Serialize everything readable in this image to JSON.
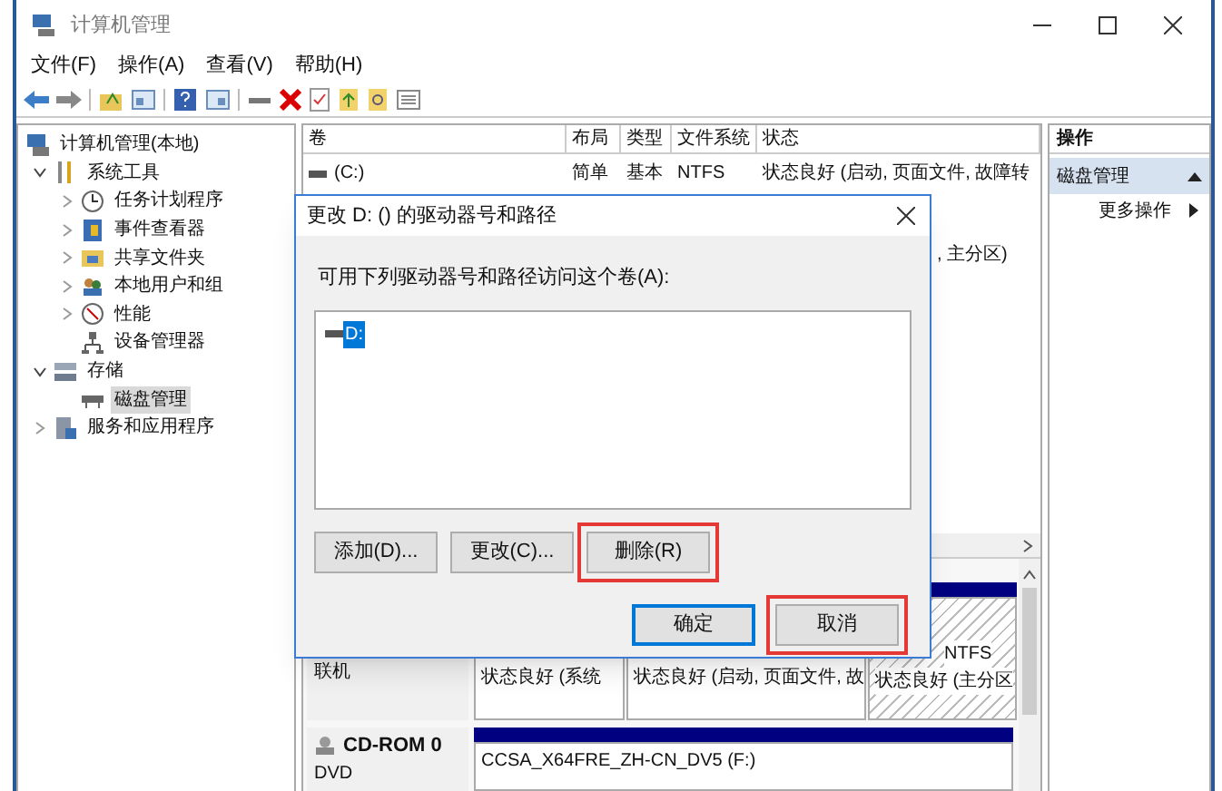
{
  "window": {
    "title": "计算机管理"
  },
  "menu": [
    "文件(F)",
    "操作(A)",
    "查看(V)",
    "帮助(H)"
  ],
  "tree": [
    {
      "label": "计算机管理(本地)",
      "selected": false,
      "children": [
        {
          "label": "系统工具",
          "expanded": true,
          "selected": false,
          "children": [
            {
              "label": "任务计划程序",
              "expanded": false,
              "selected": false
            },
            {
              "label": "事件查看器",
              "expanded": false,
              "selected": false
            },
            {
              "label": "共享文件夹",
              "expanded": false,
              "selected": false
            },
            {
              "label": "本地用户和组",
              "expanded": false,
              "selected": false
            },
            {
              "label": "性能",
              "expanded": false,
              "selected": false
            },
            {
              "label": "设备管理器",
              "selected": false
            }
          ]
        },
        {
          "label": "存储",
          "expanded": true,
          "selected": false,
          "children": [
            {
              "label": "磁盘管理",
              "selected": true
            }
          ]
        },
        {
          "label": "服务和应用程序",
          "expanded": false,
          "selected": false
        }
      ]
    }
  ],
  "table": {
    "columns": [
      "卷",
      "布局",
      "类型",
      "文件系统",
      "状态"
    ],
    "rows": [
      {
        "cells": [
          "(C:)",
          "简单",
          "基本",
          "NTFS",
          "状态良好 (启动, 页面文件, 故障转"
        ]
      }
    ],
    "covered_row_text": ", 主分区)"
  },
  "actions": {
    "title": "操作",
    "section": "磁盘管理",
    "items": [
      "更多操作"
    ]
  },
  "disks": [
    {
      "status": "联机",
      "partitions": [
        {
          "kind": "plain",
          "status": "状态良好 (系统"
        },
        {
          "kind": "plain",
          "status": "状态良好 (启动, 页面文件, 故"
        },
        {
          "kind": "hatched",
          "fs": "NTFS",
          "status": "状态良好 (主分区"
        }
      ]
    },
    {
      "name": "CD-ROM 0",
      "type": "DVD",
      "partitions": [
        {
          "kind": "plain",
          "status": "CCSA_X64FRE_ZH-CN_DV5 (F:)"
        }
      ]
    }
  ],
  "dialog": {
    "title": "更改 D: () 的驱动器号和路径",
    "prompt": "可用下列驱动器号和路径访问这个卷(A):",
    "items": [
      {
        "label": "D:",
        "selected": true
      }
    ],
    "buttons": [
      {
        "label": "添加(D)...",
        "highlighted": false,
        "default": false
      },
      {
        "label": "更改(C)...",
        "highlighted": false,
        "default": false
      },
      {
        "label": "删除(R)",
        "highlighted": true,
        "default": false
      }
    ],
    "footer_buttons": [
      {
        "label": "确定",
        "highlighted": false,
        "default": true
      },
      {
        "label": "取消",
        "highlighted": true,
        "default": false
      }
    ]
  }
}
